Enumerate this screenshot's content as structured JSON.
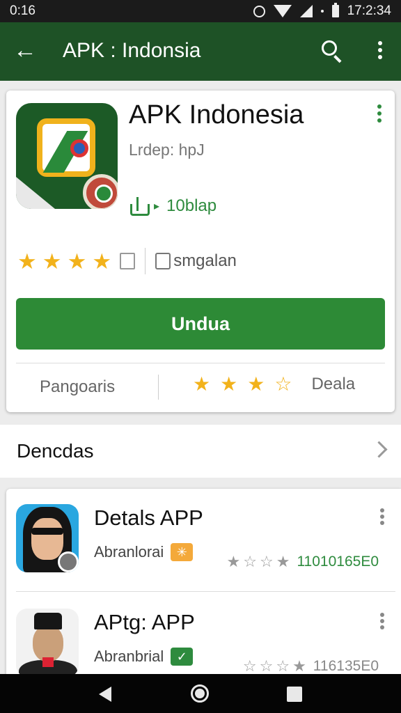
{
  "status_bar": {
    "time": "0:16",
    "clock": "17:2:34"
  },
  "app_bar": {
    "title": "APK : Indonsia"
  },
  "app_card": {
    "title": "APK Indonesia",
    "developer": "Lrdep: hpJ",
    "downloads": "10blap",
    "rating_stars": 4,
    "category": "smgalan",
    "install_label": "Undua",
    "bottom_left": "Pangoaris",
    "bottom_right": "Deala",
    "bottom_stars_filled": 3
  },
  "section": {
    "title": "Dencdas"
  },
  "list": [
    {
      "title": "Detals APP",
      "subtitle": "Abranlorai",
      "tag": "✳",
      "tag_color": "#f4a93a",
      "count": "11010165E0"
    },
    {
      "title": "APtg: APP",
      "subtitle": "Abranbrial",
      "tag": "✓",
      "tag_color": "#2e8b3e",
      "count": "116135E0"
    }
  ],
  "colors": {
    "brand": "#1e5226",
    "accent": "#2d8a36",
    "star": "#f2b21b"
  },
  "icons": [
    "back-arrow-icon",
    "search-icon",
    "more-vert-icon",
    "download-icon",
    "thumb-icon",
    "category-icon",
    "chevron-right-icon"
  ]
}
